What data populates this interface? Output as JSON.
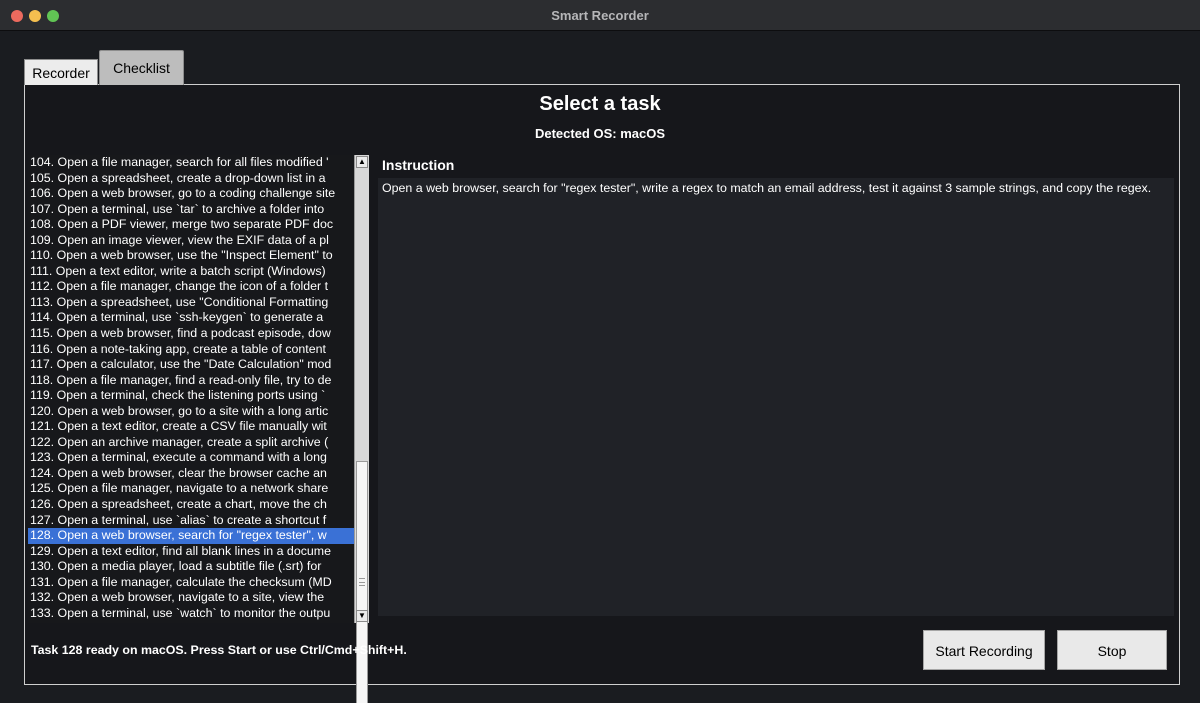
{
  "window": {
    "title": "Smart Recorder"
  },
  "tabs": [
    {
      "label": "Recorder"
    },
    {
      "label": "Checklist"
    }
  ],
  "main": {
    "heading": "Select a task",
    "os_label": "Detected OS: macOS",
    "instruction_label": "Instruction",
    "instruction_text": "Open a web browser, search for \"regex tester\", write a regex to match an email address, test it against 3 sample strings, and copy the regex.",
    "status": "Task 128 ready on macOS. Press Start or use Ctrl/Cmd+Shift+H.",
    "start_label": "Start Recording",
    "stop_label": "Stop"
  },
  "tasks": [
    "104. Open a file manager, search for all files modified '",
    "105. Open a spreadsheet, create a drop-down list in a",
    "106. Open a web browser, go to a coding challenge site",
    "107. Open a terminal, use `tar` to archive a folder into",
    "108. Open a PDF viewer, merge two separate PDF doc",
    "109. Open an image viewer, view the EXIF data of a pl",
    "110. Open a web browser, use the \"Inspect Element\" to",
    "111. Open a text editor, write a batch script (Windows)",
    "112. Open a file manager, change the icon of a folder t",
    "113. Open a spreadsheet, use \"Conditional Formatting",
    "114. Open a terminal, use `ssh-keygen` to generate a",
    "115. Open a web browser, find a podcast episode, dow",
    "116. Open a note-taking app, create a table of content",
    "117. Open a calculator, use the \"Date Calculation\" mod",
    "118. Open a file manager, find a read-only file, try to de",
    "119. Open a terminal, check the listening ports using `",
    "120. Open a web browser, go to a site with a long artic",
    "121. Open a text editor, create a CSV file manually wit",
    "122. Open an archive manager, create a split archive (",
    "123. Open a terminal, execute a command with a long",
    "124. Open a web browser, clear the browser cache an",
    "125. Open a file manager, navigate to a network share",
    "126. Open a spreadsheet, create a chart, move the ch",
    "127. Open a terminal, use `alias` to create a shortcut f",
    "128. Open a web browser, search for \"regex tester\", w",
    "129. Open a text editor, find all blank lines in a docume",
    "130. Open a media player, load a subtitle file (.srt) for",
    "131. Open a file manager, calculate the checksum (MD",
    "132. Open a web browser, navigate to a site, view the",
    "133. Open a terminal, use `watch` to monitor the outpu"
  ],
  "selected_task_index": 24,
  "colors": {
    "selection": "#3a71d6",
    "background": "#16171b",
    "instruction_bg": "#202227"
  }
}
